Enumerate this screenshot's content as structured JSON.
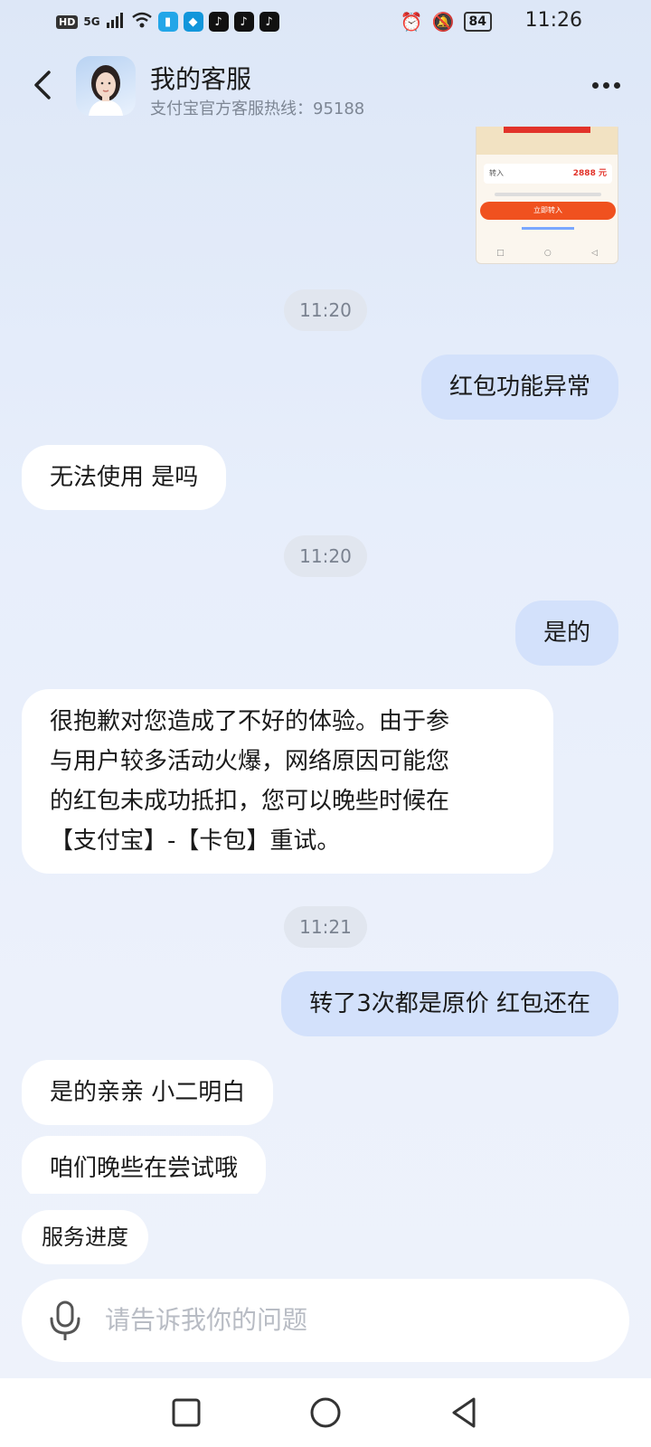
{
  "status_bar": {
    "left_badges": [
      "HD",
      "5G"
    ],
    "time": "11:26",
    "battery": "84",
    "icons": [
      "signal-icon",
      "wifi-icon",
      "book-app-icon",
      "blue-app-icon",
      "tiktok-icon",
      "tiktok-icon",
      "tiktok-icon",
      "alarm-icon",
      "mute-icon",
      "battery-icon"
    ]
  },
  "header": {
    "title": "我的客服",
    "subtitle": "支付宝官方客服热线：95188"
  },
  "thumbnail": {
    "label": "转入",
    "amount": "2888",
    "unit": "元",
    "button": "立即转入"
  },
  "messages": [
    {
      "type": "time",
      "text": "11:20"
    },
    {
      "type": "sent",
      "text": "红包功能异常"
    },
    {
      "type": "received",
      "text": "无法使用 是吗"
    },
    {
      "type": "time",
      "text": "11:20"
    },
    {
      "type": "sent",
      "text": "是的"
    },
    {
      "type": "received",
      "lines": [
        "很抱歉对您造成了不好的体验。由于参",
        "与用户较多活动火爆，网络原因可能您",
        "的红包未成功抵扣，您可以晚些时候在",
        "【支付宝】-【卡包】重试。"
      ]
    },
    {
      "type": "time",
      "text": "11:21"
    },
    {
      "type": "sent",
      "text": "转了3次都是原价 红包还在"
    },
    {
      "type": "received",
      "text": "是的亲亲 小二明白"
    },
    {
      "type": "received",
      "text": "咱们晚些在尝试哦"
    }
  ],
  "quick_reply": "服务进度",
  "input": {
    "placeholder": "请告诉我你的问题"
  },
  "colors": {
    "sent_bubble": "#d3e1fb",
    "received_bubble": "#ffffff",
    "background": "#e7eefb",
    "placeholder": "#b8bcc4"
  }
}
